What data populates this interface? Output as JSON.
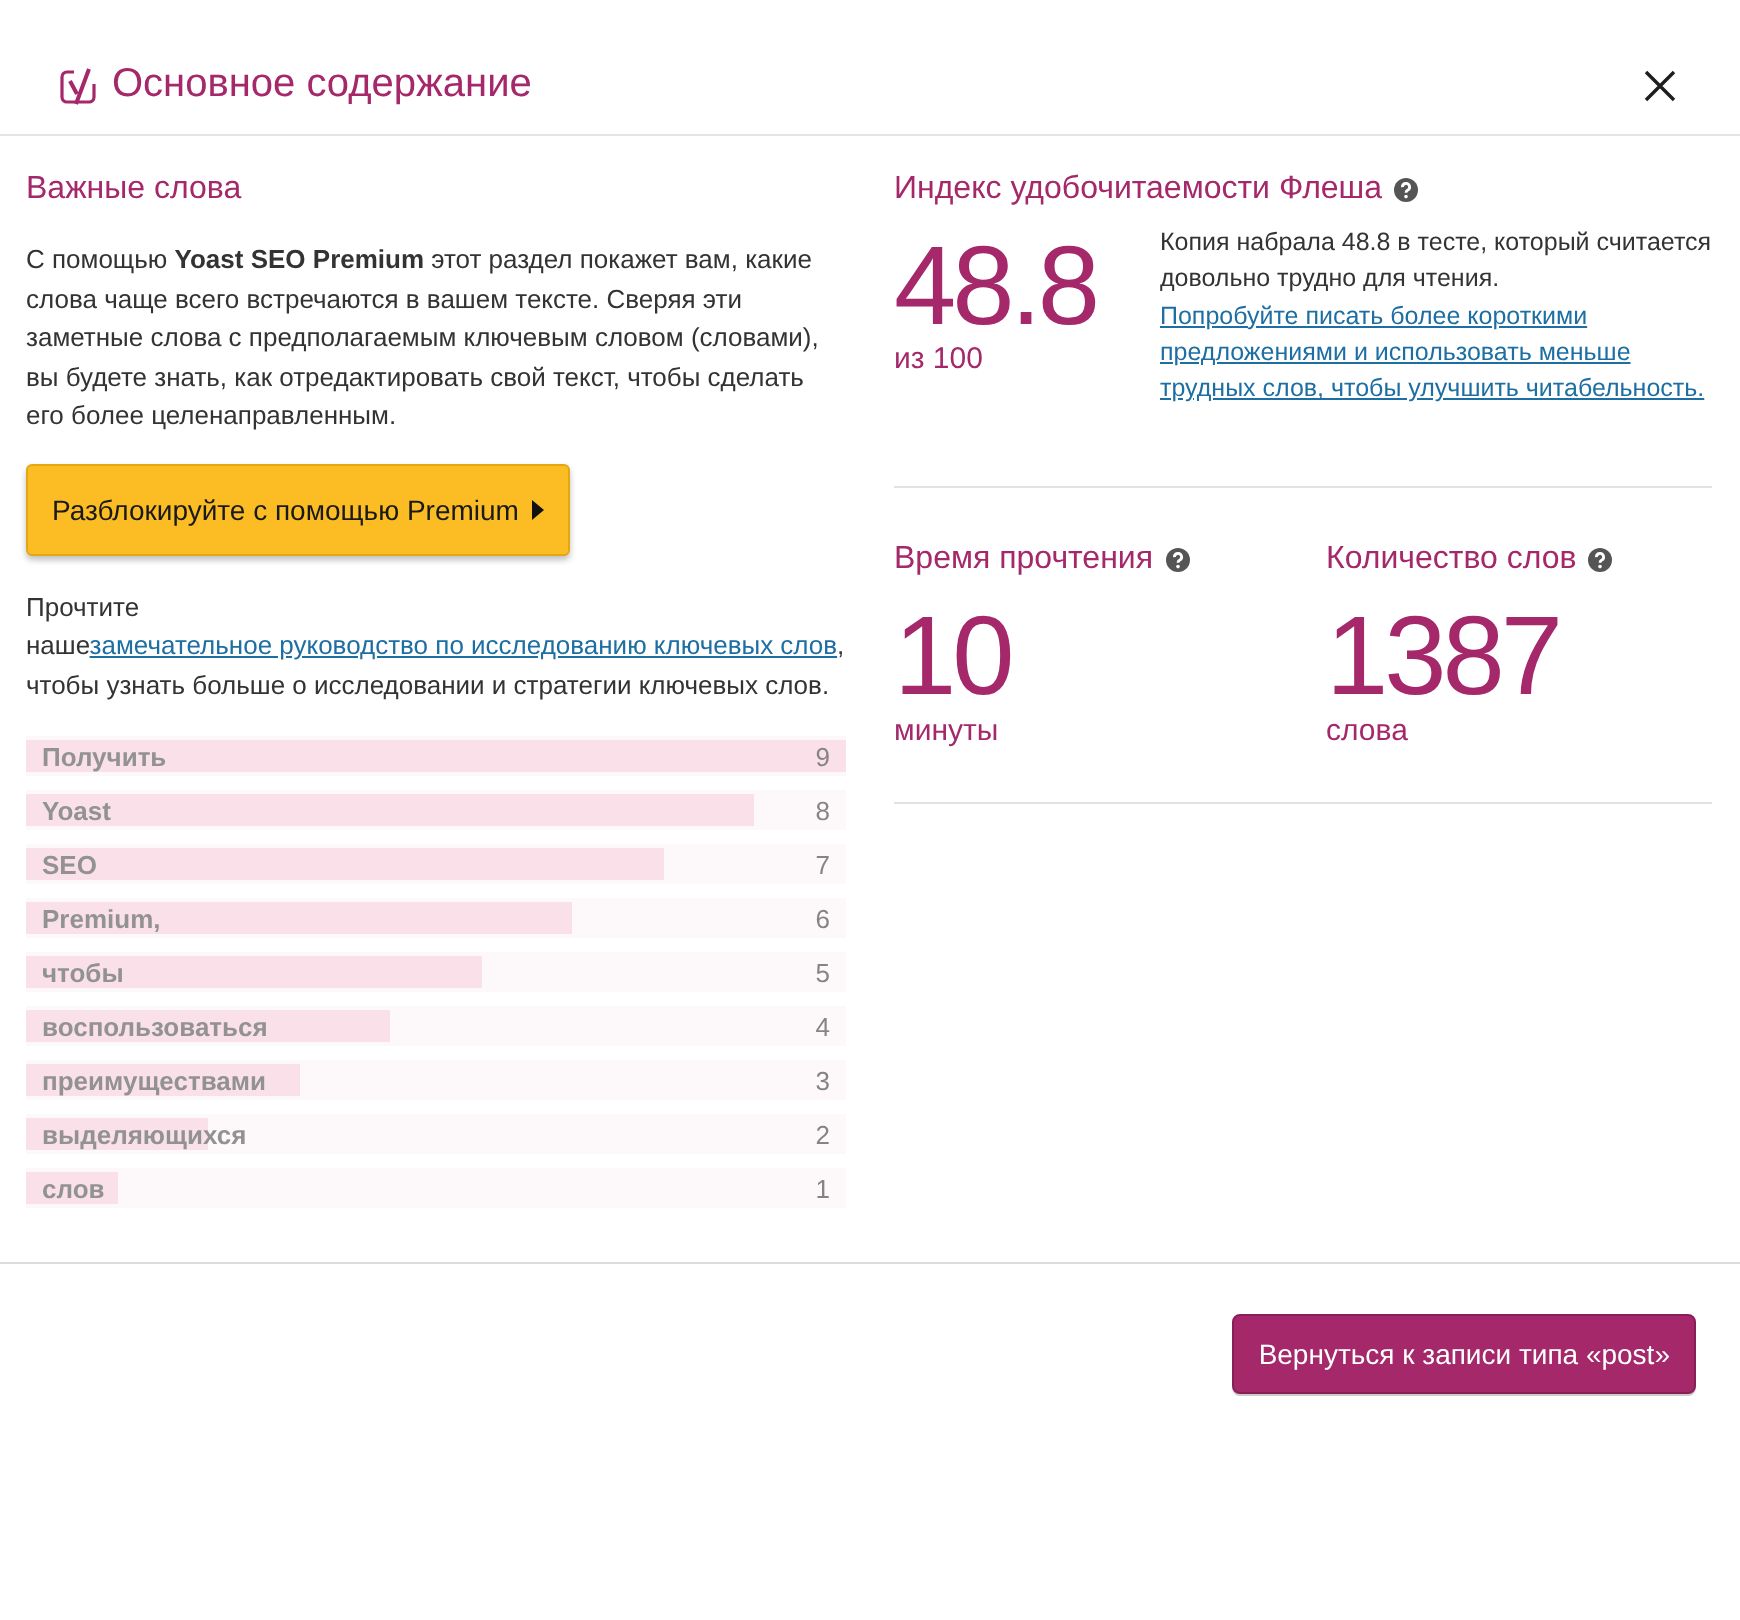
{
  "dialog": {
    "title": "Основное содержание"
  },
  "keywords": {
    "heading": "Важные слова",
    "intro": "С помощью **Yoast SEO Premium** этот раздел покажет вам, какие слова чаще всего встречаются в вашем тексте. Сверяя эти заметные слова с предполагаемым ключевым словом (словами), вы будете знать, как отредактировать свой текст, чтобы сделать его более целенаправленным.",
    "unlock_button": "Разблокируйте с помощью Premium",
    "guide_before": "Прочтите наше",
    "guide_link": "замечательное руководство по исследованию ключевых слов",
    "guide_after": ", чтобы узнать больше о исследовании и стратегии ключевых слов.",
    "locked": true,
    "words": [
      {
        "word": "Получить",
        "count": "9",
        "level": 1
      },
      {
        "word": "Yoast",
        "count": "8",
        "level": 0.889
      },
      {
        "word": "SEO",
        "count": "7",
        "level": 0.778
      },
      {
        "word": "Premium,",
        "count": "6",
        "level": 0.667
      },
      {
        "word": "чтобы",
        "count": "5",
        "level": 0.556
      },
      {
        "word": "воспользоваться",
        "count": "4",
        "level": 0.444
      },
      {
        "word": "преимуществами",
        "count": "3",
        "level": 0.333
      },
      {
        "word": "выделяющихся",
        "count": "2",
        "level": 0.222
      },
      {
        "word": "слов",
        "count": "1",
        "level": 0.111
      }
    ]
  },
  "flesch": {
    "heading": "Индекс удобочитаемости Флеша",
    "score": "48.8",
    "scale": "из 100",
    "text": "Копия набрала 48.8 в тесте, который считается довольно трудно для чтения.",
    "link": "Попробуйте писать более короткими предложениями и использовать меньше трудных слов, чтобы улучшить читабельность."
  },
  "stats": [
    {
      "heading": "Время прочтения",
      "value": "10",
      "unit": "минуты"
    },
    {
      "heading": "Количество слов",
      "value": "1387",
      "unit": "слова"
    }
  ],
  "footer": {
    "button": "Вернуться к записи типа «post»"
  }
}
